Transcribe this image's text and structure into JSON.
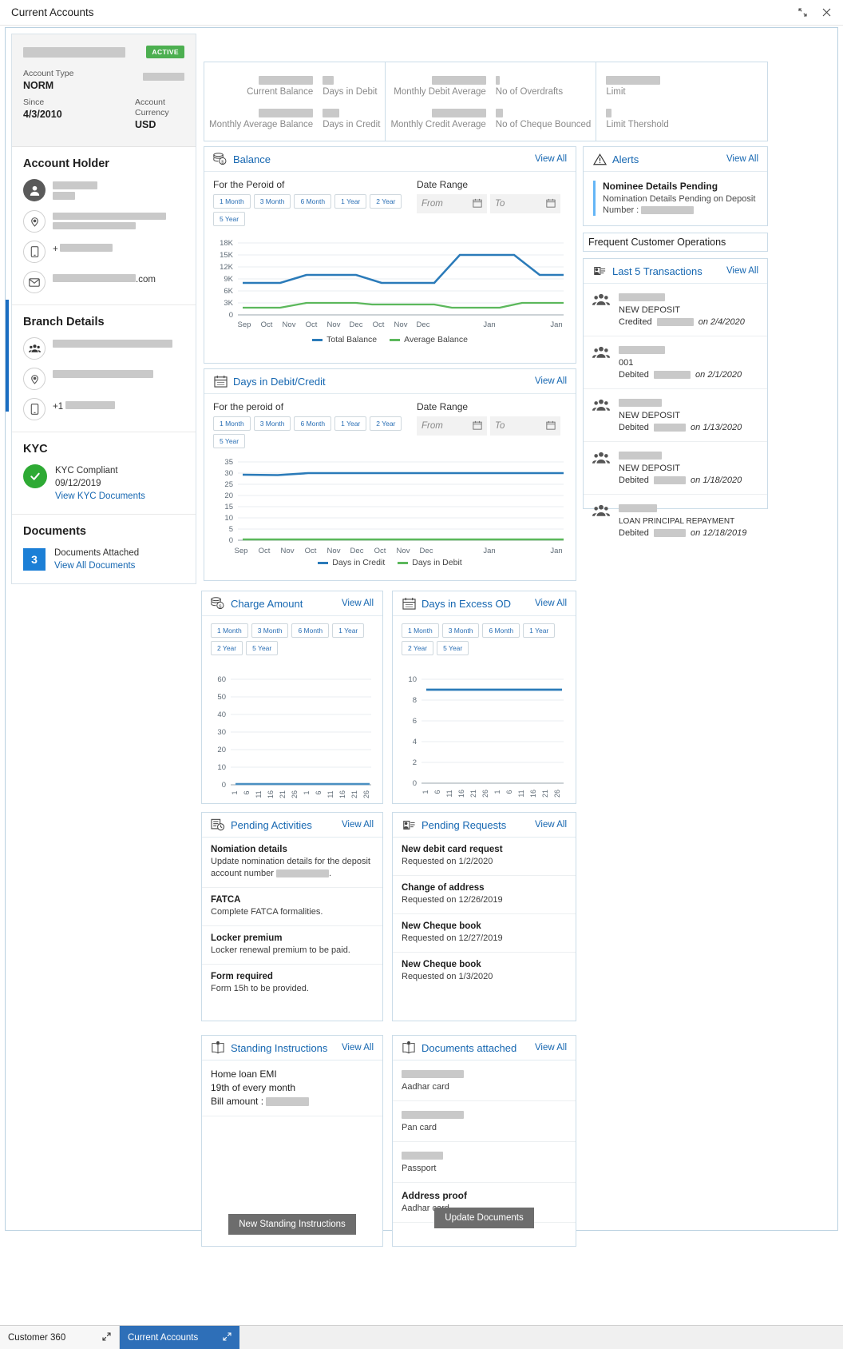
{
  "window": {
    "title": "Current Accounts",
    "restore_icon": "restore-icon",
    "close_icon": "close-icon"
  },
  "account_summary": {
    "status_badge": "ACTIVE",
    "account_type_label": "Account Type",
    "account_type_value": "NORM",
    "since_label": "Since",
    "since_value": "4/3/2010",
    "currency_label": "Account Currency",
    "currency_value": "USD"
  },
  "account_holder": {
    "heading": "Account Holder",
    "phone_prefix": "+",
    "email_suffix": ".com"
  },
  "branch_details": {
    "heading": "Branch Details",
    "phone_prefix": "+1"
  },
  "kyc": {
    "heading": "KYC",
    "status": "KYC Compliant",
    "date": "09/12/2019",
    "link": "View KYC Documents"
  },
  "documents": {
    "heading": "Documents",
    "count": "3",
    "attached_label": "Documents Attached",
    "link": "View All Documents"
  },
  "stats": [
    {
      "label": "Current Balance",
      "redact_w": 68
    },
    {
      "label": "Days in Debit",
      "redact_w": 14
    },
    {
      "label": "Monthly Average Balance",
      "redact_w": 68
    },
    {
      "label": "Days in Credit",
      "redact_w": 21
    },
    {
      "label": "Monthly Debit Average",
      "redact_w": 68
    },
    {
      "label": "No of Overdrafts",
      "redact_w": 5
    },
    {
      "label": "Monthly Credit Average",
      "redact_w": 68
    },
    {
      "label": "No of Cheque Bounced",
      "redact_w": 9
    },
    {
      "label": "Limit",
      "redact_w": 68
    },
    {
      "label": "Limit Thershold",
      "redact_w": 7
    }
  ],
  "balance_card": {
    "title": "Balance",
    "icon": "money-stack-icon",
    "view_all": "View All",
    "period_label": "For the Peroid of",
    "periods": [
      "1 Month",
      "3 Month",
      "6 Month",
      "1 Year",
      "2 Year",
      "5 Year"
    ],
    "date_range_label": "Date Range",
    "from_placeholder": "From",
    "to_placeholder": "To"
  },
  "debit_credit_card": {
    "title": "Days in Debit/Credit",
    "icon": "calendar-icon",
    "view_all": "View All",
    "period_label": "For the peroid of",
    "periods": [
      "1 Month",
      "3 Month",
      "6 Month",
      "1 Year",
      "2 Year",
      "5 Year"
    ],
    "date_range_label": "Date Range",
    "from_placeholder": "From",
    "to_placeholder": "To"
  },
  "charge_card": {
    "title": "Charge Amount",
    "icon": "money-stack-icon",
    "view_all": "View All",
    "periods": [
      "1 Month",
      "3 Month",
      "6 Month",
      "1 Year",
      "2 Year",
      "5 Year"
    ]
  },
  "excess_od_card": {
    "title": "Days in Excess OD",
    "icon": "calendar-icon",
    "view_all": "View All",
    "periods": [
      "1 Month",
      "3 Month",
      "6 Month",
      "1 Year",
      "2 Year",
      "5 Year"
    ]
  },
  "alerts": {
    "title": "Alerts",
    "icon": "warning-triangle-icon",
    "view_all": "View All",
    "item_title": "Nominee Details Pending",
    "item_desc_line1": "Nomination Details Pending on Deposit",
    "item_desc_line2_prefix": "Number : "
  },
  "frequent_ops": {
    "label": "Frequent Customer Operations"
  },
  "transactions": {
    "title": "Last 5 Transactions",
    "icon": "transactions-icon",
    "view_all": "View All",
    "items": [
      {
        "name": "NEW DEPOSIT",
        "action": "Credited",
        "date_prefix": "on ",
        "date": "2/4/2020",
        "amount_w": 46,
        "ref_w": 58
      },
      {
        "name": "001",
        "action": "Debited",
        "date_prefix": "on ",
        "date": "2/1/2020",
        "amount_w": 46,
        "ref_w": 58
      },
      {
        "name": "NEW DEPOSIT",
        "action": "Debited",
        "date_prefix": "on ",
        "date": "1/13/2020",
        "amount_w": 40,
        "ref_w": 54
      },
      {
        "name": "NEW DEPOSIT",
        "action": "Debited",
        "date_prefix": "on ",
        "date": "1/18/2020",
        "amount_w": 40,
        "ref_w": 54
      },
      {
        "name": "LOAN PRINCIPAL REPAYMENT",
        "action": "Debited",
        "date_prefix": "on ",
        "date": "12/18/2019",
        "amount_w": 40,
        "ref_w": 48
      }
    ]
  },
  "pending_activities": {
    "title": "Pending Activities",
    "icon": "pending-activities-icon",
    "view_all": "View All",
    "items": [
      {
        "title": "Nomiation details",
        "desc_pre": "Update nomination details for the deposit account number ",
        "desc_post": ".",
        "redacted": true
      },
      {
        "title": "FATCA",
        "desc_pre": "Complete FATCA formalities.",
        "desc_post": "",
        "redacted": false
      },
      {
        "title": "Locker premium",
        "desc_pre": "Locker renewal premium to be paid.",
        "desc_post": "",
        "redacted": false
      },
      {
        "title": "Form required",
        "desc_pre": "Form 15h to be provided.",
        "desc_post": "",
        "redacted": false
      }
    ]
  },
  "pending_requests": {
    "title": "Pending Requests",
    "icon": "pending-requests-icon",
    "view_all": "View All",
    "items": [
      {
        "title": "New debit card request",
        "desc": "Requested on 1/2/2020"
      },
      {
        "title": "Change of address",
        "desc": "Requested on 12/26/2019"
      },
      {
        "title": "New Cheque book",
        "desc": "Requested on 12/27/2019"
      },
      {
        "title": "New Cheque book",
        "desc": "Requested on 1/3/2020"
      }
    ]
  },
  "standing_instructions": {
    "title": "Standing Instructions",
    "icon": "book-icon",
    "view_all": "View All",
    "line1": "Home loan EMI",
    "line2": "19th of every month",
    "line3_prefix": "Bill amount : ",
    "button": "New Standing Instructions"
  },
  "documents_attached": {
    "title": "Documents attached",
    "icon": "book-icon",
    "view_all": "View All",
    "items": [
      {
        "label": "Aadhar card",
        "redact_w": 78
      },
      {
        "label": "Pan card",
        "redact_w": 78
      },
      {
        "label": "Passport",
        "redact_w": 52
      },
      {
        "label": "Aadhar card",
        "title_text": "Address proof"
      }
    ],
    "button": "Update Documents"
  },
  "taskbar": {
    "items": [
      {
        "label": "Customer 360",
        "active": false,
        "expand_icon": "expand-icon"
      },
      {
        "label": "Current Accounts",
        "active": true,
        "expand_icon": "expand-icon"
      }
    ]
  },
  "colors": {
    "accent_blue": "#1667b1",
    "series_blue": "#2b7bb9",
    "series_green": "#5cb85c",
    "active_green": "#4caf50"
  },
  "chart_data": [
    {
      "id": "balance",
      "type": "line",
      "title": "Balance",
      "xlabel": "",
      "ylabel": "",
      "ylim": [
        0,
        18000
      ],
      "yticks": [
        0,
        3000,
        6000,
        9000,
        12000,
        15000,
        18000
      ],
      "ytick_labels": [
        "0",
        "3K",
        "6K",
        "9K",
        "12K",
        "15K",
        "18K"
      ],
      "categories": [
        "Sep",
        "Oct",
        "Nov",
        "Oct",
        "Nov",
        "Dec",
        "Oct",
        "Nov",
        "Dec",
        "Jan",
        "Jan"
      ],
      "grid": true,
      "legend_position": "bottom",
      "series": [
        {
          "name": "Total Balance",
          "color": "#2b7bb9",
          "values": [
            8000,
            8000,
            8000,
            10000,
            10000,
            10000,
            8000,
            8000,
            8000,
            15000,
            15000,
            10000,
            10000
          ]
        },
        {
          "name": "Average Balance",
          "color": "#5cb85c",
          "values": [
            1800,
            1800,
            1800,
            3000,
            3000,
            3000,
            2400,
            2400,
            2400,
            1800,
            1800,
            3000,
            3000
          ]
        }
      ]
    },
    {
      "id": "days_debit_credit",
      "type": "line",
      "title": "Days in Debit/Credit",
      "xlabel": "",
      "ylabel": "",
      "ylim": [
        0,
        35
      ],
      "yticks": [
        0,
        5,
        10,
        15,
        20,
        25,
        30,
        35
      ],
      "ytick_labels": [
        "0",
        "5",
        "10",
        "15",
        "20",
        "25",
        "30",
        "35"
      ],
      "categories": [
        "Sep",
        "Oct",
        "Nov",
        "Oct",
        "Nov",
        "Dec",
        "Oct",
        "Nov",
        "Dec",
        "Jan",
        "Jan"
      ],
      "grid": true,
      "legend_position": "bottom",
      "series": [
        {
          "name": "Days in Credit",
          "color": "#2b7bb9",
          "values": [
            30,
            30,
            30,
            31,
            31,
            31,
            31,
            31,
            31,
            31,
            31
          ]
        },
        {
          "name": "Days in Debit",
          "color": "#5cb85c",
          "values": [
            0,
            0,
            0,
            0,
            0,
            0,
            0,
            0,
            0,
            0,
            0
          ]
        }
      ]
    },
    {
      "id": "charge_amount",
      "type": "line",
      "title": "Charge Amount",
      "xlabel": "",
      "ylabel": "",
      "ylim": [
        0,
        60
      ],
      "yticks": [
        0,
        10,
        20,
        30,
        40,
        50,
        60
      ],
      "ytick_labels": [
        "0",
        "10",
        "20",
        "30",
        "40",
        "50",
        "60"
      ],
      "categories": [
        "1",
        "6",
        "11",
        "16",
        "21",
        "26",
        "1",
        "6",
        "11",
        "16",
        "21",
        "26"
      ],
      "grid": true,
      "legend_position": "none",
      "series": [
        {
          "name": "Charge Amount",
          "color": "#2b7bb9",
          "values": [
            0,
            0,
            0,
            0,
            0,
            0,
            0,
            0,
            0,
            0,
            0,
            0
          ]
        }
      ]
    },
    {
      "id": "days_excess_od",
      "type": "line",
      "title": "Days in Excess OD",
      "xlabel": "",
      "ylabel": "",
      "ylim": [
        0,
        10
      ],
      "yticks": [
        0,
        2,
        4,
        6,
        8,
        10
      ],
      "ytick_labels": [
        "0",
        "2",
        "4",
        "6",
        "8",
        "10"
      ],
      "categories": [
        "1",
        "6",
        "11",
        "16",
        "21",
        "26",
        "1",
        "6",
        "11",
        "16",
        "21",
        "26"
      ],
      "grid": true,
      "legend_position": "none",
      "series": [
        {
          "name": "Days in Excess OD",
          "color": "#2b7bb9",
          "values": [
            9,
            9,
            9,
            9,
            9,
            9,
            9,
            9,
            9,
            9,
            9,
            9
          ]
        }
      ]
    }
  ]
}
